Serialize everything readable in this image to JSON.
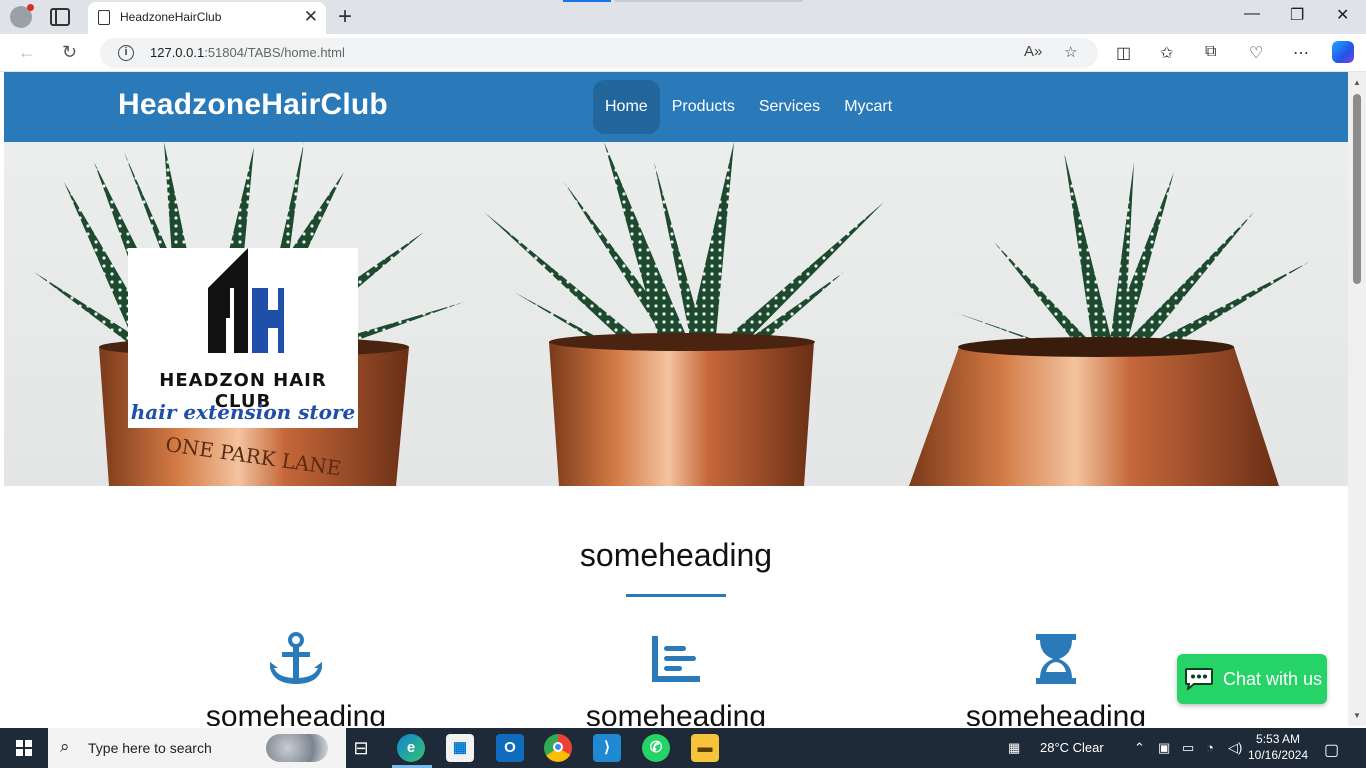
{
  "browser": {
    "tab_title": "HeadzoneHairClub",
    "url_host": "127.0.0.1",
    "url_rest": ":51804/TABS/home.html"
  },
  "site": {
    "brand": "HeadzoneHairClub",
    "nav": [
      {
        "label": "Home",
        "active": true
      },
      {
        "label": "Products",
        "active": false
      },
      {
        "label": "Services",
        "active": false
      },
      {
        "label": "Mycart",
        "active": false
      }
    ],
    "logo": {
      "line1": "HEADZON HAIR CLUB",
      "line2": "hair extension store"
    },
    "hero_engraving": "ONE PARK LANE",
    "section_title": "someheading",
    "features": [
      {
        "icon": "anchor-icon",
        "heading": "someheading"
      },
      {
        "icon": "chart-icon",
        "heading": "someheading"
      },
      {
        "icon": "hourglass-icon",
        "heading": "someheading"
      }
    ],
    "chat_label": "Chat with us",
    "colors": {
      "primary": "#2a7ab9",
      "chat": "#25d366"
    }
  },
  "taskbar": {
    "search_placeholder": "Type here to search",
    "weather": "28°C  Clear",
    "time": "5:53 AM",
    "date": "10/16/2024"
  }
}
